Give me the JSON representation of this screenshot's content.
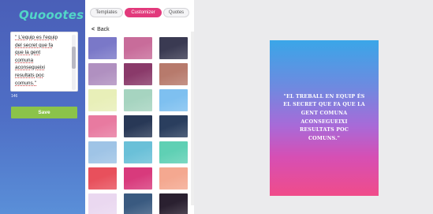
{
  "app": {
    "logo_text": "Quoootes"
  },
  "editor": {
    "quote_text": "'' L'equip es l'equip\ndel secret que fa\nque la gent\ncomuna\naconsegueixi\nresultats poc\ncomuns.''",
    "char_count": "146",
    "save_label": "Save"
  },
  "tabs": [
    {
      "label": "Templates",
      "active": false
    },
    {
      "label": "Customizer",
      "active": true
    },
    {
      "label": "Quotes",
      "active": false
    }
  ],
  "back_label": "Back",
  "backgrounds": [
    "#7a78c8",
    "#c86c9a",
    "#3a3a52",
    "#b090c0",
    "#8a3a6a",
    "#b77a6c",
    "#e8efb8",
    "#a6d4c0",
    "#7ec0f0",
    "#e87aa0",
    "#283856",
    "#2a3e5e",
    "#9fc4e6",
    "#6ac0d8",
    "#5fd0b4",
    "#e8505c",
    "#d83a7c",
    "#f4a890",
    "#ead8f0",
    "#3a5a80",
    "#2a2030"
  ],
  "preview": {
    "quote": "\"EL TREBALL EN EQUIP ÉS EL SECRET QUE FA QUE LA GENT COMUNA ACONSEGUEIXI RESULTATS POC COMUNS.\"",
    "gradient_top": "#3aa6e8",
    "gradient_bottom": "#f04c8a"
  },
  "colors": {
    "accent_tab": "#e23a7c",
    "save_button": "#8bc34a",
    "logo": "#52d6c8"
  }
}
